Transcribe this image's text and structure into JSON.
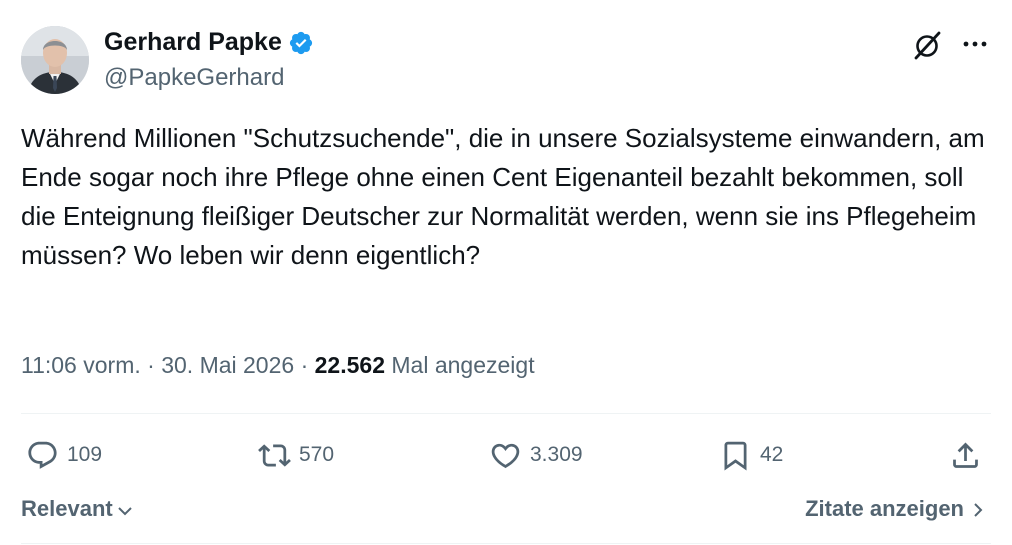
{
  "author": {
    "name": "Gerhard Papke",
    "handle": "@PapkeGerhard",
    "verified": true,
    "verified_color": "#1d9bf0"
  },
  "tweet": {
    "text": "Während Millionen \"Schutzsuchende\", die in unsere Sozialsysteme einwandern, am Ende sogar noch ihre Pflege ohne einen Cent Eigenanteil bezahlt bekommen, soll die Enteignung fleißiger Deutscher zur Normalität werden, wenn sie ins Pflegeheim müssen? Wo leben wir denn eigentlich?",
    "time": "11:06 vorm.",
    "separator": "·",
    "date": "30. Mai 2026",
    "views_count": "22.562",
    "views_label": "Mal angezeigt"
  },
  "actions": {
    "replies": "109",
    "retweets": "570",
    "likes": "3.309",
    "bookmarks": "42"
  },
  "footer": {
    "sort_label": "Relevant",
    "quotes_label": "Zitate anzeigen"
  },
  "icons": {
    "header": [
      "grok-icon",
      "more-icon"
    ],
    "actions": [
      "reply-icon",
      "retweet-icon",
      "like-icon",
      "bookmark-icon",
      "share-icon"
    ]
  }
}
